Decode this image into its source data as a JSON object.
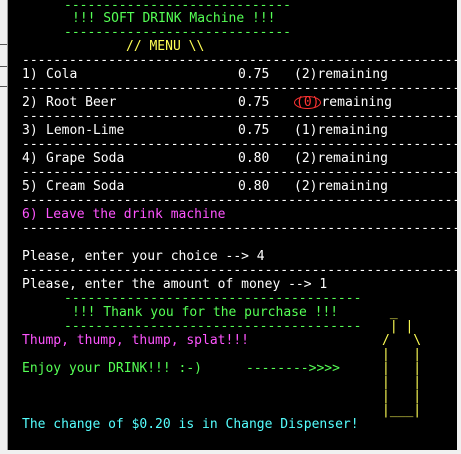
{
  "title": "!!! SOFT DRINK Machine !!!",
  "menu_header": "// MENU \\\\",
  "menu": [
    {
      "index": "1)",
      "name": "Cola",
      "price": "0.75",
      "remaining_count": "(2)",
      "remaining_label": "remaining"
    },
    {
      "index": "2)",
      "name": "Root Beer",
      "price": "0.75",
      "remaining_count": "(0)",
      "remaining_label": "remaining"
    },
    {
      "index": "3)",
      "name": "Lemon-Lime",
      "price": "0.75",
      "remaining_count": "(1)",
      "remaining_label": "remaining"
    },
    {
      "index": "4)",
      "name": "Grape Soda",
      "price": "0.80",
      "remaining_count": "(2)",
      "remaining_label": "remaining"
    },
    {
      "index": "5)",
      "name": "Cream Soda",
      "price": "0.80",
      "remaining_count": "(2)",
      "remaining_label": "remaining"
    }
  ],
  "leave_option": "6) Leave the drink machine",
  "prompt_choice": "Please, enter your choice --> 4",
  "prompt_money": "Please, enter the amount of money --> 1",
  "thanks": "!!! Thank you for the purchase !!!",
  "thump": "Thump, thump, thump, splat!!!",
  "enjoy": "Enjoy your DRINK!!! :-)",
  "arrow": "-------->>>>",
  "change": "The change of $0.20 is in Change Dispenser!",
  "bottle_art": " _\n | |\n/   \\\n|   |\n|   |\n|   |\n|   |\n|___|",
  "colors": {
    "background": "#000000",
    "title_green": "#55ff55",
    "menu_yellow": "#ffff55",
    "leave_magenta": "#ff55ff",
    "change_cyan": "#55ffff",
    "sold_out_red": "#ff3333"
  }
}
